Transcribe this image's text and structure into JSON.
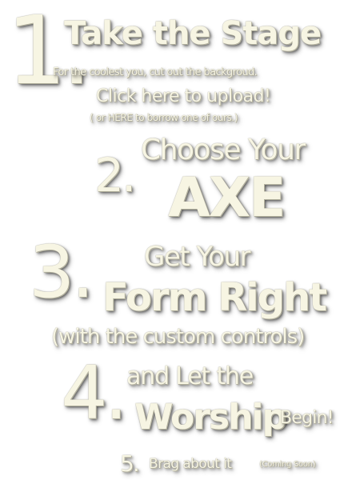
{
  "steps": {
    "step1": {
      "number": "1.",
      "title": "Take the Stage",
      "subtitle": "For the coolest you, cut out the backgroud.",
      "upload_link": "Click here to upload!",
      "borrow_link": "( or HERE to borrow one of ours.)"
    },
    "step2": {
      "number": "2.",
      "title": "Choose Your",
      "highlight": "AXE"
    },
    "step3": {
      "number": "3.",
      "line1": "Get Your",
      "line2": "Form Right",
      "line3": "(with the custom controls)"
    },
    "step4": {
      "number": "4.",
      "line1": "and Let the",
      "highlight": "Worship",
      "suffix": "Begin!"
    },
    "step5": {
      "number": "5.",
      "text": "Brag about it",
      "note": "(Coming Soon)"
    }
  },
  "colors": {
    "text": "#f7f5e3",
    "shadow": "#000000",
    "background": "#ffffff"
  }
}
